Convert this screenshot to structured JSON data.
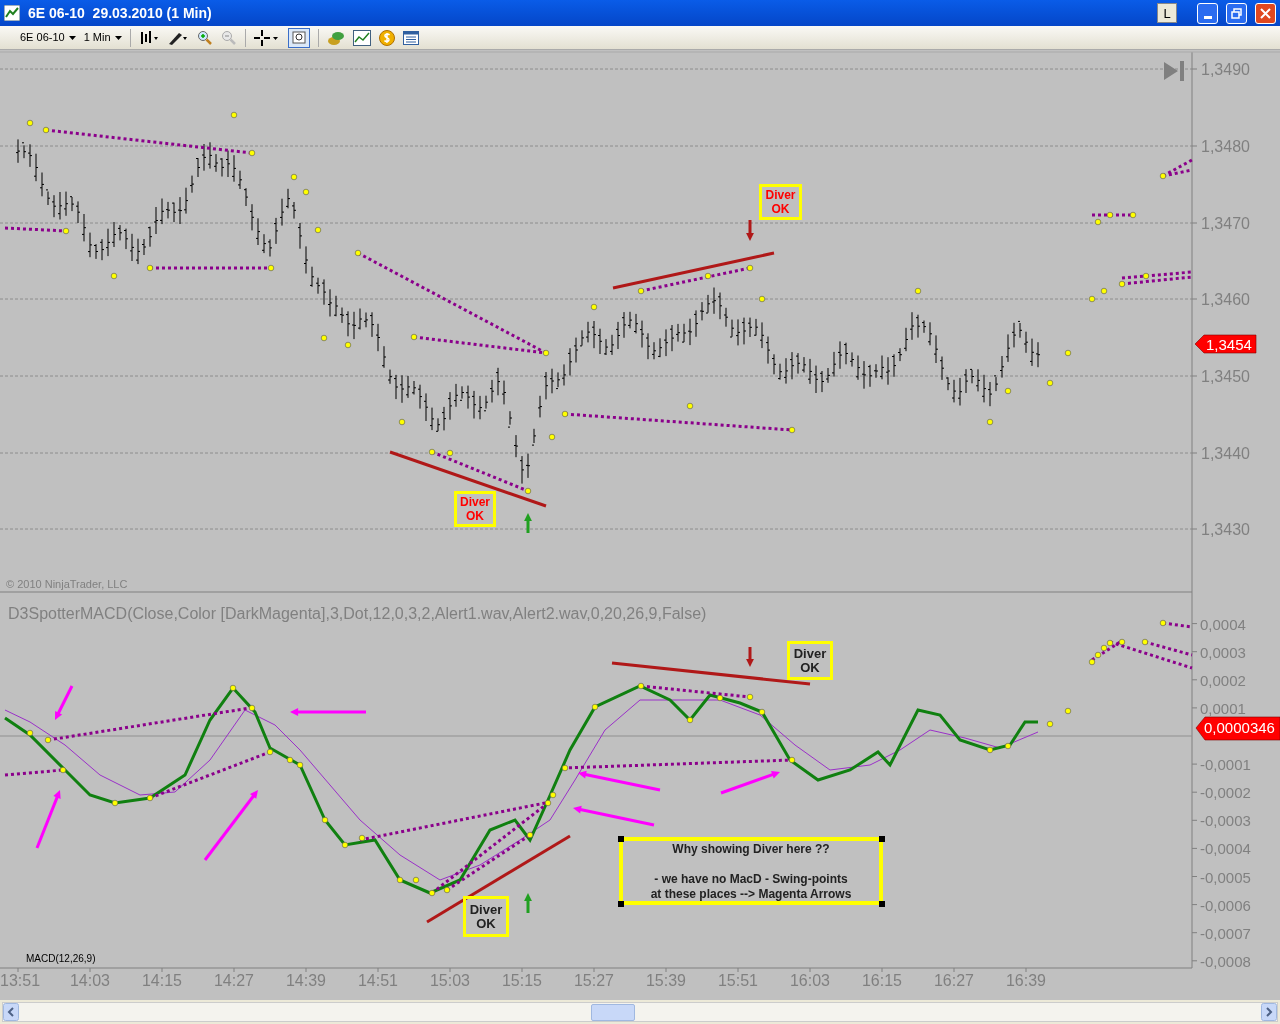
{
  "window": {
    "title": "6E 06-10  29.03.2010 (1 Min)",
    "buttons": [
      "L"
    ]
  },
  "toolbar": {
    "instrument": "6E 06-10",
    "interval": "1 Min"
  },
  "price_panel": {
    "y_axis": [
      "1,3490",
      "1,3480",
      "1,3470",
      "1,3460",
      "1,3450",
      "1,3440",
      "1,3430"
    ],
    "last_price": "1,3454",
    "copyright": "© 2010 NinjaTrader, LLC",
    "annotations": [
      {
        "lines": [
          "Diver",
          "OK"
        ]
      },
      {
        "lines": [
          "Diver",
          "OK"
        ]
      }
    ]
  },
  "indicator_panel": {
    "title": "D3SpotterMACD(Close,Color  [DarkMagenta],3,Dot,12,0,3,2,Alert1.wav,Alert2.wav,0,20,26,9,False)",
    "label": "MACD(12,26,9)",
    "y_axis": [
      "0,0004",
      "0,0003",
      "0,0002",
      "0,0001",
      "-0,0001",
      "-0,0002",
      "-0,0003",
      "-0,0004",
      "-0,0005",
      "-0,0006",
      "-0,0007",
      "-0,0008"
    ],
    "last_value": "0,0000346",
    "annotations": [
      {
        "lines": [
          "Diver",
          "OK"
        ]
      },
      {
        "lines": [
          "Diver",
          "OK"
        ]
      }
    ],
    "note": {
      "title": "Why showing Diver here ??",
      "lines": [
        "- we have no MacD - Swing-points",
        "at these places --> Magenta Arrows"
      ]
    }
  },
  "time_axis": [
    "13:51",
    "14:03",
    "14:15",
    "14:27",
    "14:39",
    "14:51",
    "15:03",
    "15:15",
    "15:27",
    "15:39",
    "15:51",
    "16:03",
    "16:15",
    "16:27",
    "16:39"
  ]
}
